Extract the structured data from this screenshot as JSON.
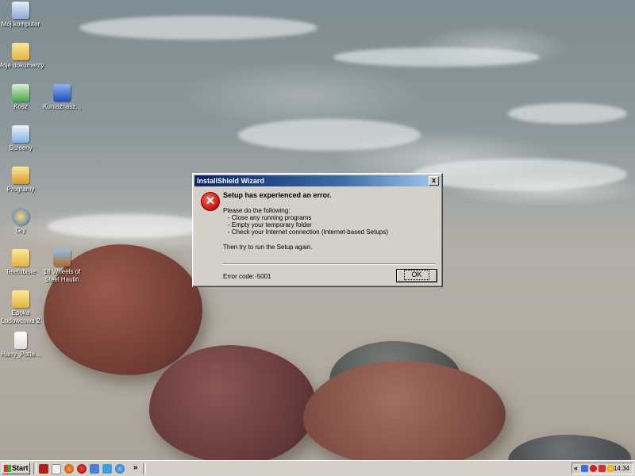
{
  "desktop": {
    "icons": [
      {
        "label": "Mój komputer"
      },
      {
        "label": "Moje dokumenty"
      },
      {
        "label": "Kosz"
      },
      {
        "label": "Kuniaznasz..."
      },
      {
        "label": "Screeny"
      },
      {
        "label": "Programy"
      },
      {
        "label": "Gry"
      },
      {
        "label": "Teletubisie"
      },
      {
        "label": "18 Wheels of Steel Haulin"
      },
      {
        "label": "Epoka Lodowcowa 2"
      },
      {
        "label": "Harry_Potte..."
      }
    ]
  },
  "dialog": {
    "title": "InstallShield Wizard",
    "close_label": "x",
    "heading": "Setup has experienced an error.",
    "intro": "Please do the following:",
    "steps": [
      "Close any running programs",
      "Empty your temporary folder",
      "Check your Internet connection (Internet-based Setups)"
    ],
    "retry": "Then try to run the Setup again.",
    "error_code_label": "Error code:",
    "error_code_value": "-5001",
    "ok_label": "OK",
    "icon": "error-icon"
  },
  "taskbar": {
    "start_label": "Start",
    "quicklaunch_more": "»",
    "tray_expand": "«",
    "clock": "14:34"
  },
  "colors": {
    "titlebar_start": "#0a246a",
    "titlebar_end": "#a6caf0",
    "window_face": "#d4d0c8",
    "error_red": "#c8100a"
  }
}
